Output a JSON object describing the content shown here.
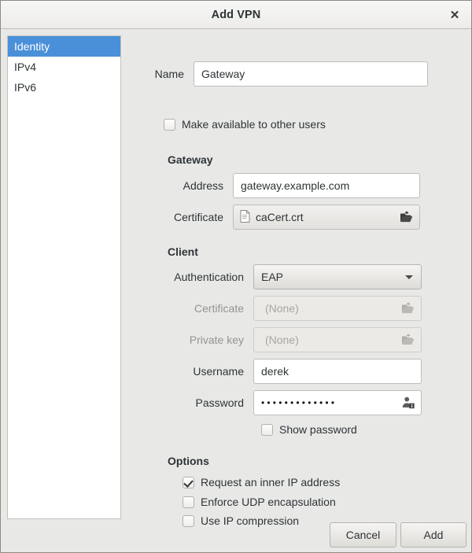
{
  "window": {
    "title": "Add VPN",
    "close_icon": "close-icon"
  },
  "sidebar": {
    "items": [
      {
        "label": "Identity",
        "selected": true
      },
      {
        "label": "IPv4",
        "selected": false
      },
      {
        "label": "IPv6",
        "selected": false
      }
    ]
  },
  "form": {
    "name": {
      "label": "Name",
      "value": "Gateway"
    },
    "make_available": {
      "label": "Make available to other users",
      "checked": false
    },
    "gateway": {
      "section": "Gateway",
      "address": {
        "label": "Address",
        "value": "gateway.example.com"
      },
      "certificate": {
        "label": "Certificate",
        "value": "caCert.crt",
        "file_icon": "document-icon",
        "open_icon": "open-folder-icon",
        "disabled": false
      }
    },
    "client": {
      "section": "Client",
      "authentication": {
        "label": "Authentication",
        "value": "EAP",
        "dropdown_icon": "chevron-down-icon"
      },
      "certificate": {
        "label": "Certificate",
        "value": "(None)",
        "open_icon": "open-folder-icon",
        "disabled": true
      },
      "private_key": {
        "label": "Private key",
        "value": "(None)",
        "open_icon": "open-folder-icon",
        "disabled": true
      },
      "username": {
        "label": "Username",
        "value": "derek"
      },
      "password": {
        "label": "Password",
        "value": "•••••••••••••",
        "store_icon": "user-info-icon"
      },
      "show_password": {
        "label": "Show password",
        "checked": false
      }
    },
    "options": {
      "section": "Options",
      "items": [
        {
          "label": "Request an inner IP address",
          "checked": true
        },
        {
          "label": "Enforce UDP encapsulation",
          "checked": false
        },
        {
          "label": "Use IP compression",
          "checked": false
        }
      ]
    }
  },
  "footer": {
    "cancel_label": "Cancel",
    "add_label": "Add"
  },
  "colors": {
    "selection_blue": "#4a90d9",
    "window_bg": "#e8e8e7",
    "text": "#2e3436",
    "disabled_text": "#a8a6a1"
  }
}
